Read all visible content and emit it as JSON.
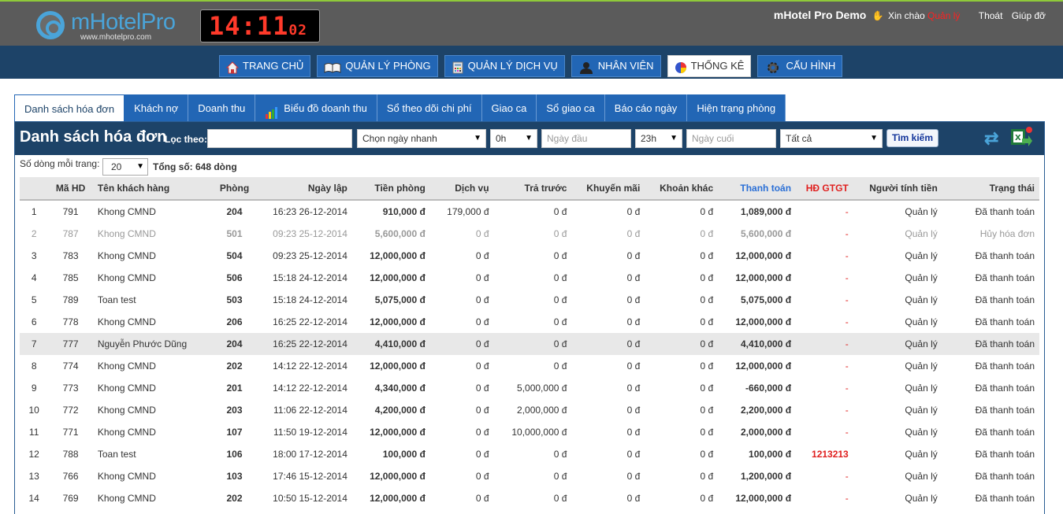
{
  "header": {
    "logo_text": "mHotelPro",
    "logo_url": "www.mhotelpro.com",
    "clock_hm": "14:11",
    "clock_sec": "02",
    "app_name": "mHotel Pro Demo",
    "greeting": "Xin chào",
    "user": "Quản lý",
    "logout": "Thoát",
    "help": "Giúp đỡ"
  },
  "nav": [
    {
      "label": "TRANG CHỦ",
      "icon": "home-icon"
    },
    {
      "label": "QUẢN LÝ PHÒNG",
      "icon": "book-icon"
    },
    {
      "label": "QUẢN LÝ DỊCH VỤ",
      "icon": "calculator-icon"
    },
    {
      "label": "NHÂN VIÊN",
      "icon": "user-icon"
    },
    {
      "label": "THỐNG KÊ",
      "icon": "pie-chart-icon",
      "active": true
    },
    {
      "label": "CẤU HÌNH",
      "icon": "gear-icon"
    }
  ],
  "tabs": [
    {
      "label": "Danh sách hóa đơn",
      "active": true
    },
    {
      "label": "Khách nợ"
    },
    {
      "label": "Doanh thu"
    },
    {
      "label": "Biểu đồ doanh thu",
      "icon": "bar-chart-icon"
    },
    {
      "label": "Sổ theo dõi chi phí"
    },
    {
      "label": "Giao ca"
    },
    {
      "label": "Sổ giao ca"
    },
    {
      "label": "Báo cáo ngày"
    },
    {
      "label": "Hiện trạng phòng"
    }
  ],
  "filter": {
    "title": "Danh sách hóa đơn",
    "label": "Lọc theo:",
    "quick_date": "Chọn ngày nhanh",
    "from_hour": "0h",
    "from_date_placeholder": "Ngày đầu",
    "to_hour": "23h",
    "to_date_placeholder": "Ngày cuối",
    "status": "Tất cả",
    "search_button": "Tìm kiếm"
  },
  "paging": {
    "rows_label": "Số dòng mỗi trang:",
    "rows_value": "20",
    "total": "Tổng số: 648 dòng"
  },
  "table": {
    "columns": [
      "",
      "Mã HD",
      "Tên khách hàng",
      "Phòng",
      "Ngày lập",
      "Tiền phòng",
      "Dịch vụ",
      "Trả trước",
      "Khuyến mãi",
      "Khoản khác",
      "Thanh toán",
      "HĐ GTGT",
      "Người tính tiền",
      "Trạng thái"
    ],
    "rows": [
      [
        "1",
        "791",
        "Khong CMND",
        "204",
        "16:23 26-12-2014",
        "910,000 đ",
        "179,000 đ",
        "0 đ",
        "0 đ",
        "0 đ",
        "1,089,000 đ",
        "-",
        "Quản lý",
        "Đã thanh toán"
      ],
      [
        "2",
        "787",
        "Khong CMND",
        "501",
        "09:23 25-12-2014",
        "5,600,000 đ",
        "0 đ",
        "0 đ",
        "0 đ",
        "0 đ",
        "5,600,000 đ",
        "-",
        "Quản lý",
        "Hủy hóa đơn"
      ],
      [
        "3",
        "783",
        "Khong CMND",
        "504",
        "09:23 25-12-2014",
        "12,000,000 đ",
        "0 đ",
        "0 đ",
        "0 đ",
        "0 đ",
        "12,000,000 đ",
        "-",
        "Quản lý",
        "Đã thanh toán"
      ],
      [
        "4",
        "785",
        "Khong CMND",
        "506",
        "15:18 24-12-2014",
        "12,000,000 đ",
        "0 đ",
        "0 đ",
        "0 đ",
        "0 đ",
        "12,000,000 đ",
        "-",
        "Quản lý",
        "Đã thanh toán"
      ],
      [
        "5",
        "789",
        "Toan test",
        "503",
        "15:18 24-12-2014",
        "5,075,000 đ",
        "0 đ",
        "0 đ",
        "0 đ",
        "0 đ",
        "5,075,000 đ",
        "-",
        "Quản lý",
        "Đã thanh toán"
      ],
      [
        "6",
        "778",
        "Khong CMND",
        "206",
        "16:25 22-12-2014",
        "12,000,000 đ",
        "0 đ",
        "0 đ",
        "0 đ",
        "0 đ",
        "12,000,000 đ",
        "-",
        "Quản lý",
        "Đã thanh toán"
      ],
      [
        "7",
        "777",
        "Nguyễn Phước Dũng",
        "204",
        "16:25 22-12-2014",
        "4,410,000 đ",
        "0 đ",
        "0 đ",
        "0 đ",
        "0 đ",
        "4,410,000 đ",
        "-",
        "Quản lý",
        "Đã thanh toán"
      ],
      [
        "8",
        "774",
        "Khong CMND",
        "202",
        "14:12 22-12-2014",
        "12,000,000 đ",
        "0 đ",
        "0 đ",
        "0 đ",
        "0 đ",
        "12,000,000 đ",
        "-",
        "Quản lý",
        "Đã thanh toán"
      ],
      [
        "9",
        "773",
        "Khong CMND",
        "201",
        "14:12 22-12-2014",
        "4,340,000 đ",
        "0 đ",
        "5,000,000 đ",
        "0 đ",
        "0 đ",
        "-660,000 đ",
        "-",
        "Quản lý",
        "Đã thanh toán"
      ],
      [
        "10",
        "772",
        "Khong CMND",
        "203",
        "11:06 22-12-2014",
        "4,200,000 đ",
        "0 đ",
        "2,000,000 đ",
        "0 đ",
        "0 đ",
        "2,200,000 đ",
        "-",
        "Quản lý",
        "Đã thanh toán"
      ],
      [
        "11",
        "771",
        "Khong CMND",
        "107",
        "11:50 19-12-2014",
        "12,000,000 đ",
        "0 đ",
        "10,000,000 đ",
        "0 đ",
        "0 đ",
        "2,000,000 đ",
        "-",
        "Quản lý",
        "Đã thanh toán"
      ],
      [
        "12",
        "788",
        "Toan test",
        "106",
        "18:00 17-12-2014",
        "100,000 đ",
        "0 đ",
        "0 đ",
        "0 đ",
        "0 đ",
        "100,000 đ",
        "1213213",
        "Quản lý",
        "Đã thanh toán"
      ],
      [
        "13",
        "766",
        "Khong CMND",
        "103",
        "17:46 15-12-2014",
        "12,000,000 đ",
        "0 đ",
        "0 đ",
        "0 đ",
        "0 đ",
        "1,200,000 đ",
        "-",
        "Quản lý",
        "Đã thanh toán"
      ],
      [
        "14",
        "769",
        "Khong CMND",
        "202",
        "10:50 15-12-2014",
        "12,000,000 đ",
        "0 đ",
        "0 đ",
        "0 đ",
        "0 đ",
        "12,000,000 đ",
        "-",
        "Quản lý",
        "Đã thanh toán"
      ]
    ],
    "highlight_row": 7,
    "cancelled_row": 2
  },
  "colors": {
    "header_bg": "#5b5b5b",
    "nav_bg": "#1d4368",
    "button_blue": "#2266b5",
    "accent_red": "#e0201f",
    "pay_blue": "#2a6fd6"
  }
}
